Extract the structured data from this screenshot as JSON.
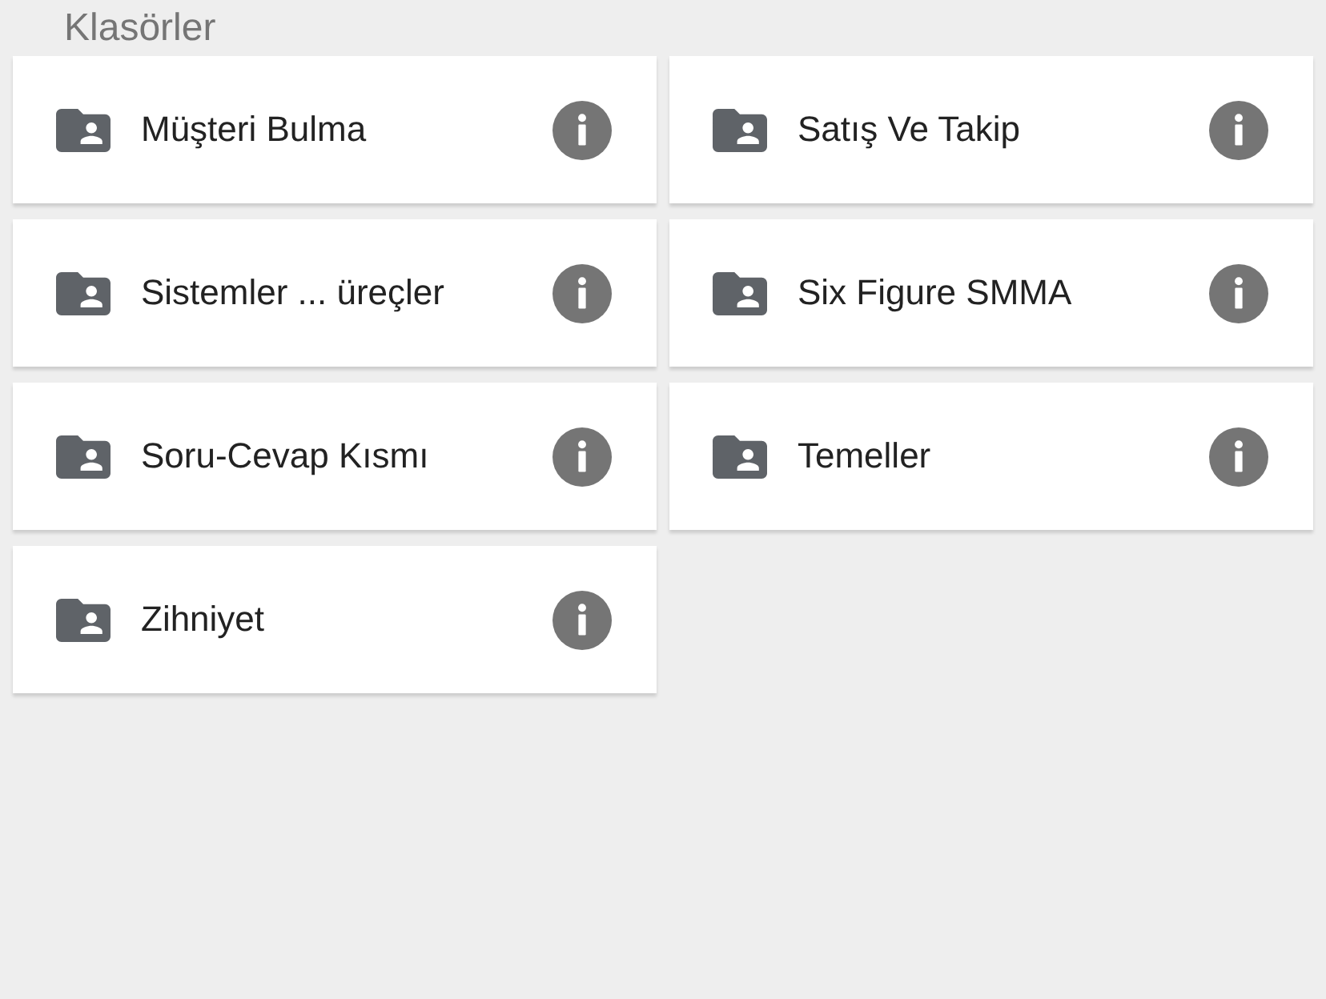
{
  "title": "Klasörler",
  "folders": [
    {
      "name": "Müşteri Bulma"
    },
    {
      "name": "Satış Ve Takip"
    },
    {
      "name": "Sistemler ... üreçler"
    },
    {
      "name": "Six Figure SMMA"
    },
    {
      "name": "Soru-Cevap Kısmı"
    },
    {
      "name": "Temeller"
    },
    {
      "name": "Zihniyet"
    }
  ]
}
